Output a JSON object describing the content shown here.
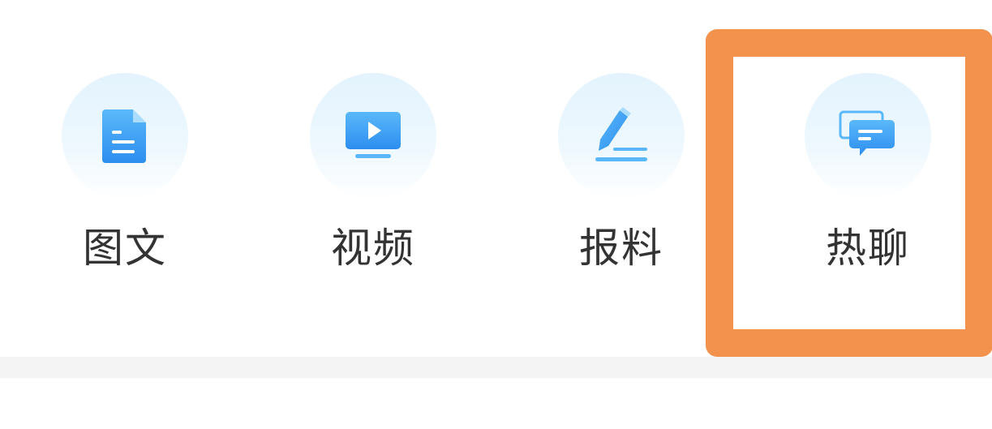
{
  "actions": [
    {
      "id": "image-text",
      "label": "图文",
      "icon": "document-icon"
    },
    {
      "id": "video",
      "label": "视频",
      "icon": "video-play-icon"
    },
    {
      "id": "report",
      "label": "报料",
      "icon": "pencil-icon"
    },
    {
      "id": "hot-chat",
      "label": "热聊",
      "icon": "chat-bubbles-icon"
    }
  ],
  "colors": {
    "icon_blue": "#2d9bf0",
    "icon_blue_light": "#5ab8fa",
    "circle_bg": "#e3f3fd",
    "label_text": "#333333",
    "highlight": "#f3924c",
    "divider": "#f4f4f4"
  }
}
